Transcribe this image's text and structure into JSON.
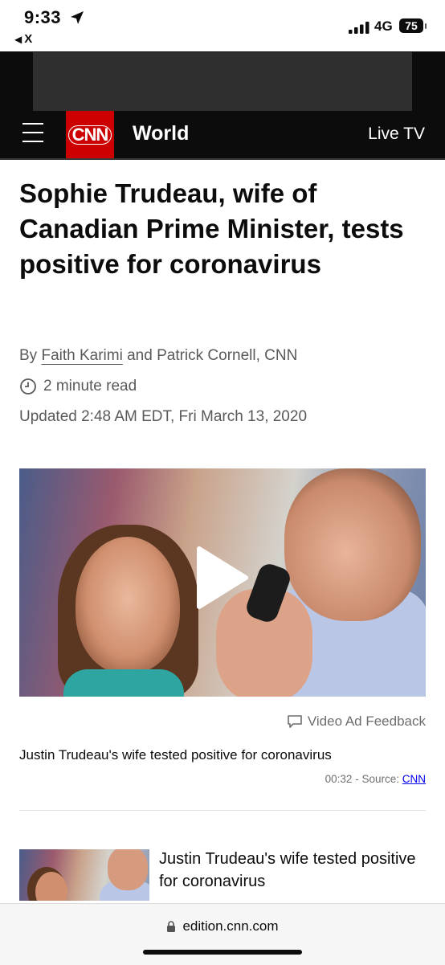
{
  "status_bar": {
    "time": "9:33",
    "back_app": "X",
    "network": "4G",
    "battery": "75"
  },
  "navbar": {
    "logo": "CNN",
    "section": "World",
    "live_tv": "Live TV"
  },
  "article": {
    "headline": "Sophie Trudeau, wife of Canadian Prime Minister, tests positive for coronavirus",
    "byline_prefix": "By",
    "author_link": "Faith Karimi",
    "byline_rest": "and Patrick Cornell, CNN",
    "read_time": "2 minute read",
    "updated": "Updated 2:48 AM EDT, Fri March 13, 2020"
  },
  "video": {
    "ad_feedback": "Video Ad Feedback",
    "caption": "Justin Trudeau's wife tested positive for coronavirus",
    "duration": "00:32",
    "source_prefix": "- Source:",
    "source_link": "CNN"
  },
  "related": {
    "title": "Justin Trudeau's wife tested positive for coronavirus"
  },
  "browser": {
    "url": "edition.cnn.com"
  },
  "colors": {
    "brand_red": "#cc0000",
    "nav_bg": "#0c0c0c",
    "meta_gray": "#595959"
  }
}
